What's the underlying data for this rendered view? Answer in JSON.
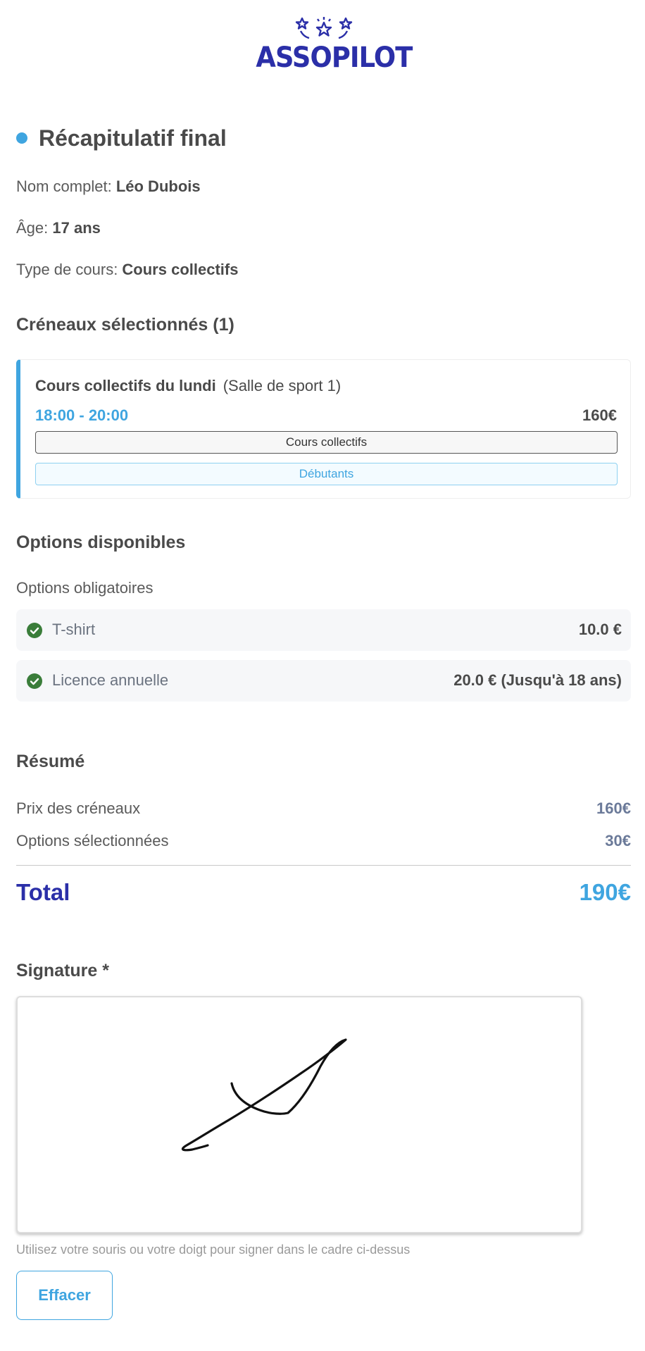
{
  "brand": {
    "logo_text": "ASSOPILOT",
    "color": "#2b2fa8"
  },
  "page_title": "Récapitulatif final",
  "participant": {
    "name_label": "Nom complet: ",
    "name_value": "Léo Dubois",
    "age_label": "Âge: ",
    "age_value": "17 ans",
    "course_type_label": "Type de cours: ",
    "course_type_value": "Cours collectifs"
  },
  "slots": {
    "heading": "Créneaux sélectionnés (1)",
    "items": [
      {
        "name": "Cours collectifs du lundi",
        "room": "(Salle de sport 1)",
        "time": "18:00 - 20:00",
        "price": "160€",
        "type_badge": "Cours collectifs",
        "level_badge": "Débutants"
      }
    ]
  },
  "options": {
    "heading": "Options disponibles",
    "mandatory_label": "Options obligatoires",
    "items": [
      {
        "name": "T-shirt",
        "price": "10.0 €",
        "icon": "check-circle-icon"
      },
      {
        "name": "Licence annuelle",
        "price": "20.0 € (Jusqu'à 18 ans)",
        "icon": "check-circle-icon"
      }
    ]
  },
  "summary": {
    "heading": "Résumé",
    "slots_price_label": "Prix des créneaux",
    "slots_price_value": "160€",
    "options_label": "Options sélectionnées",
    "options_value": "30€",
    "total_label": "Total",
    "total_value": "190€"
  },
  "signature": {
    "heading": "Signature *",
    "hint": "Utilisez votre souris ou votre doigt pour signer dans le cadre ci-dessus",
    "clear_label": "Effacer"
  },
  "colors": {
    "accent": "#3fa5e0",
    "brand": "#2b2fa8",
    "check": "#3a7d3a"
  }
}
